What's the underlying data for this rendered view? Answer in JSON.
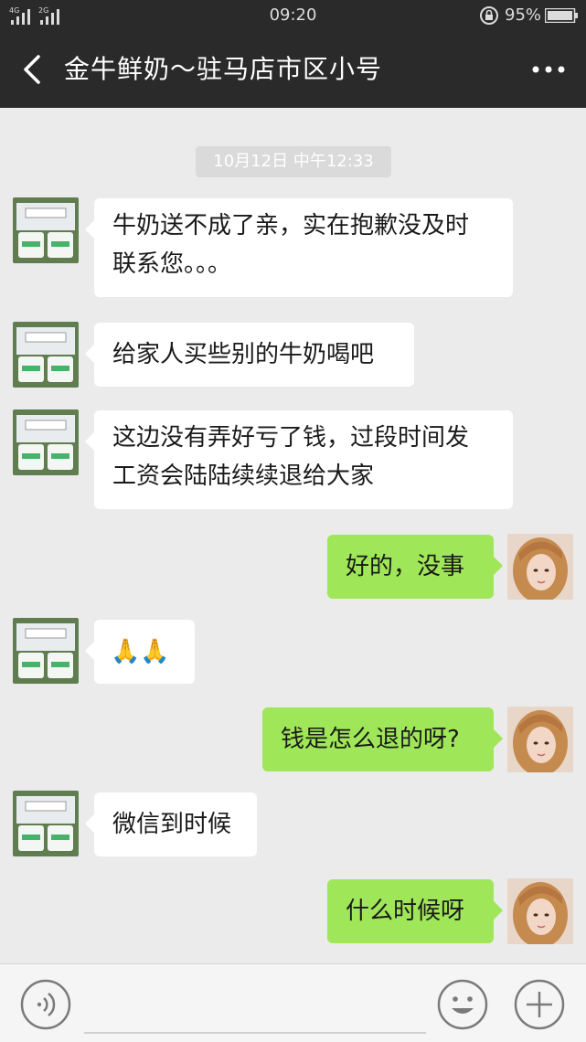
{
  "status_bar": {
    "network_1": "4G",
    "network_2": "2G",
    "time": "09:20",
    "battery": "95%"
  },
  "header": {
    "title": "金牛鲜奶～驻马店市区小号",
    "back_icon": "chevron-left-icon",
    "more_icon": "more-horizontal-icon"
  },
  "chat": {
    "timestamp": "10月12日 中午12:33",
    "messages": [
      {
        "from": "contact",
        "lines": [
          "牛奶送不成了亲，实在抱歉没及时",
          "联系您。。。"
        ]
      },
      {
        "from": "contact",
        "lines": [
          "给家人买些别的牛奶喝吧"
        ]
      },
      {
        "from": "contact",
        "lines": [
          "这边没有弄好亏了钱，过段时间发",
          "工资会陆陆续续退给大家"
        ]
      },
      {
        "from": "me",
        "lines": [
          "好的，没事"
        ]
      },
      {
        "from": "contact",
        "lines": [
          "🙏🙏"
        ]
      },
      {
        "from": "me",
        "lines": [
          "钱是怎么退的呀?"
        ]
      },
      {
        "from": "contact",
        "lines": [
          "微信到时候"
        ]
      },
      {
        "from": "me",
        "lines": [
          "什么时候呀"
        ]
      }
    ]
  },
  "input_bar": {
    "voice_icon": "voice-icon",
    "placeholder": "",
    "emoji_icon": "emoji-icon",
    "plus_icon": "plus-icon"
  },
  "colors": {
    "header_bg": "#2a2a2a",
    "chat_bg": "#ebebeb",
    "incoming_bubble": "#ffffff",
    "outgoing_bubble": "#9fe658",
    "timestamp_bg": "#dadada"
  }
}
